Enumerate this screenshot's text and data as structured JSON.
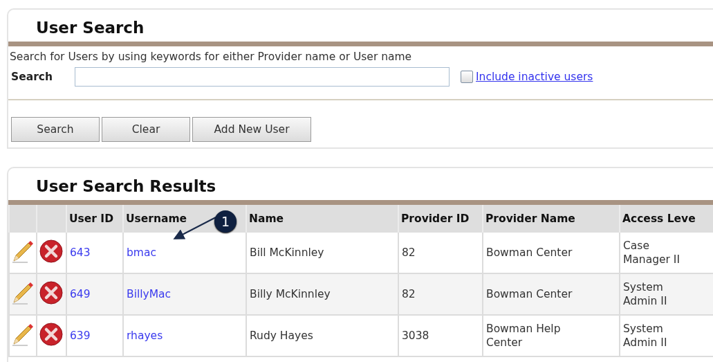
{
  "search_panel": {
    "title": "User Search",
    "description": "Search for Users by using keywords for either Provider name or User name",
    "search_label": "Search",
    "include_inactive": {
      "label": "Include inactive users",
      "checked": false
    },
    "buttons": [
      "Search",
      "Clear",
      "Add New User"
    ]
  },
  "results_panel": {
    "title": "User Search Results",
    "columns": [
      "User ID",
      "Username",
      "Name",
      "Provider ID",
      "Provider Name",
      "Access Leve"
    ],
    "callout": "1",
    "rows": [
      {
        "user_id": "643",
        "username": "bmac",
        "name": "Bill McKinnley",
        "provider_id": "82",
        "provider_name": "Bowman Center",
        "access_level": "Case Manager II"
      },
      {
        "user_id": "649",
        "username": "BillyMac",
        "name": "Billy McKinnley",
        "provider_id": "82",
        "provider_name": "Bowman Center",
        "access_level": "System Admin II"
      },
      {
        "user_id": "639",
        "username": "rhayes",
        "name": "Rudy Hayes",
        "provider_id": "3038",
        "provider_name": "Bowman Help Center",
        "access_level": "System Admin II"
      }
    ]
  }
}
